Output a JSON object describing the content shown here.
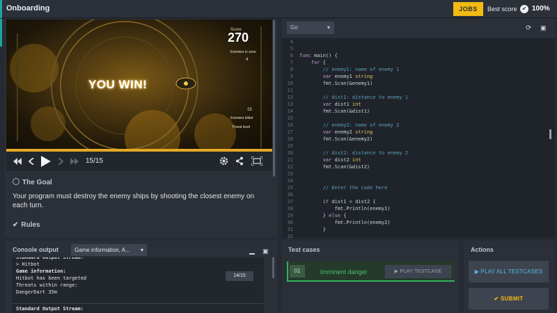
{
  "app": {
    "title": "Onboarding"
  },
  "topbar": {
    "jobs_label": "JOBS",
    "best_score_label": "Best score",
    "best_score_value": "100%"
  },
  "viewer": {
    "banner": "YOU WIN!",
    "score_label": "Score",
    "score_value": "270",
    "enemies_in_zone_label": "Enemies in zone",
    "enemies_in_zone_value": "4",
    "enemies_killed_value": "15",
    "enemies_killed_label": "Enemies killed",
    "threat_level_label": "Threat level",
    "frame": "15/15",
    "progress_fraction": 1.0
  },
  "goal": {
    "heading": "The Goal",
    "text": "Your program must destroy the enemy ships by shooting the closest enemy on each turn."
  },
  "rules": {
    "heading": "Rules"
  },
  "editor": {
    "language": "Go",
    "line_numbers": [
      "4",
      "5",
      "6",
      "7",
      "8",
      "9",
      "10",
      "11",
      "12",
      "13",
      "14",
      "15",
      "16",
      "17",
      "18",
      "19",
      "20",
      "21",
      "22",
      "23",
      "24",
      "25",
      "26",
      "27",
      "28",
      "29",
      "30",
      "31",
      "32"
    ],
    "lines": [
      "",
      "",
      "func main() {",
      "    for {",
      "        // enemy1: name of enemy 1",
      "        var enemy1 string",
      "        fmt.Scan(&enemy1)",
      "",
      "        // dist1: distance to enemy 1",
      "        var dist1 int",
      "        fmt.Scan(&dist1)",
      "",
      "        // enemy2: name of enemy 2",
      "        var enemy2 string",
      "        fmt.Scan(&enemy2)",
      "",
      "        // dist2: distance to enemy 2",
      "        var dist2 int",
      "        fmt.Scan(&dist2)",
      "",
      "",
      "        // Enter the code here",
      "",
      "        if dist1 < dist2 {",
      "            fmt.Println(enemy1)",
      "        } else {",
      "            fmt.Println(enemy2)",
      "        }",
      ""
    ]
  },
  "console": {
    "title": "Console output",
    "selector": "Game information, A...",
    "lines": [
      {
        "text": "Standard Output Stream:",
        "bold": true
      },
      {
        "text": "> Hitbot",
        "bold": false
      },
      {
        "text": "Game information:",
        "bold": true
      },
      {
        "text": "Hitbot has been targeted",
        "bold": false
      },
      {
        "text": "Threats within range:",
        "bold": false
      },
      {
        "text": "DangerDart 35m",
        "bold": false
      }
    ],
    "frame_badge": "14/15",
    "next_header": "Standard Output Stream:"
  },
  "tests": {
    "title": "Test cases",
    "items": [
      {
        "num": "01",
        "name": "Imminent danger",
        "play_label": "PLAY TESTCASE"
      }
    ]
  },
  "actions": {
    "title": "Actions",
    "play_all_label": "PLAY ALL TESTCASES",
    "submit_label": "SUBMIT"
  },
  "colors": {
    "accent_teal": "#1fa5a0",
    "jobs_yellow": "#f2bb13",
    "success_green": "#43c06b",
    "play_all_blue": "#53b9e8"
  }
}
